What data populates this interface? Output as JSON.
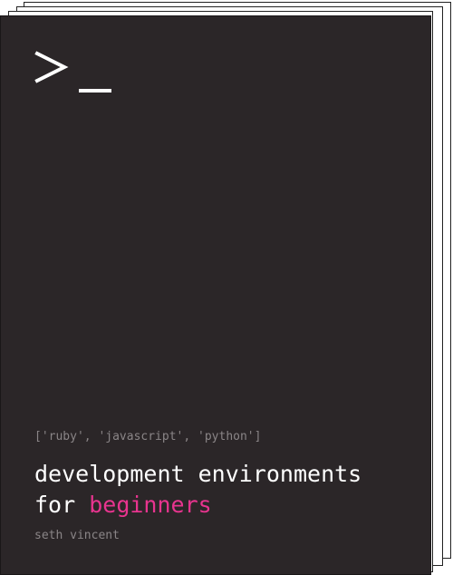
{
  "cover": {
    "background_color": "#2b2628",
    "accent_color": "#e8348f",
    "icon": "terminal-prompt-icon",
    "tags_line": "['ruby', 'javascript', 'python']",
    "title_line1": "development environments",
    "title_line2_prefix": "for ",
    "title_line2_accent": "beginners",
    "author": "seth vincent"
  }
}
